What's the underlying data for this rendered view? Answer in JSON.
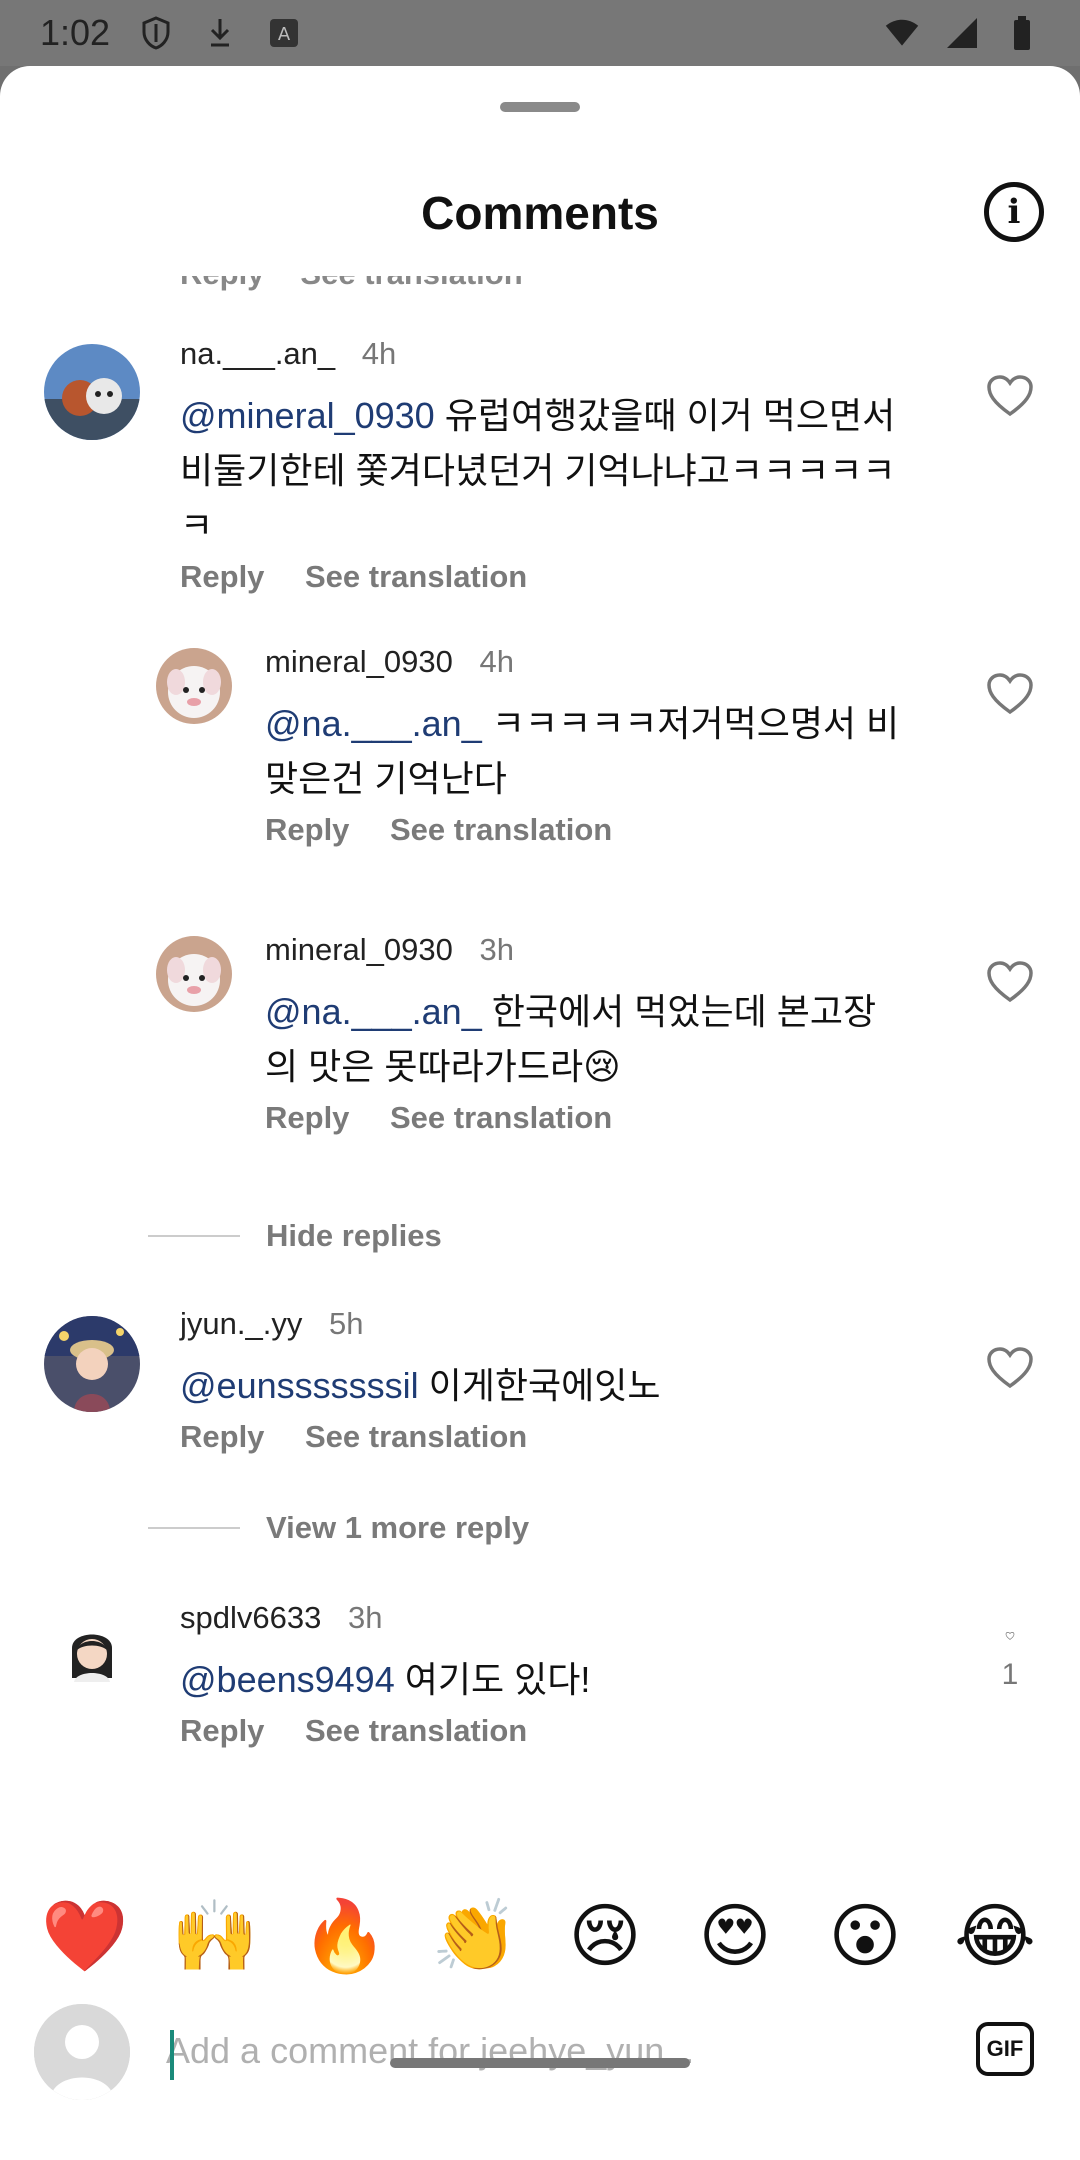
{
  "status_bar": {
    "time": "1:02"
  },
  "header": {
    "title": "Comments"
  },
  "partial": {
    "reply": "Reply",
    "see_translation": "See translation"
  },
  "comments": [
    {
      "user": "na.___.an_",
      "time": "4h",
      "mention": "@mineral_0930",
      "text": " 유럽여행갔을때 이거 먹으면서 비둘기한테 쫓겨다녔던거 기억나냐고ㅋㅋㅋㅋㅋㅋ",
      "reply": "Reply",
      "see_translation": "See translation"
    },
    {
      "user": "mineral_0930",
      "time": "4h",
      "mention": "@na.___.an_",
      "text": " ㅋㅋㅋㅋㅋ저거먹으명서 비맞은건 기억난다",
      "reply": "Reply",
      "see_translation": "See translation"
    },
    {
      "user": "mineral_0930",
      "time": "3h",
      "mention": "@na.___.an_",
      "text": " 한국에서 먹었는데 본고장의 맛은 못따라가드라😢",
      "reply": "Reply",
      "see_translation": "See translation"
    },
    {
      "user": "jyun._.yy",
      "time": "5h",
      "mention": "@eunsssssssil",
      "text": "  이게한국에잇노",
      "reply": "Reply",
      "see_translation": "See translation"
    },
    {
      "user": "spdlv6633",
      "time": "3h",
      "mention": "@beens9494",
      "text": " 여기도 있다!",
      "reply": "Reply",
      "see_translation": "See translation",
      "likes": "1"
    }
  ],
  "hide_replies": "Hide replies",
  "view_more": "View 1 more reply",
  "emojis": [
    "❤️",
    "🙌",
    "🔥",
    "👏",
    "😢",
    "😍",
    "😮",
    "😂"
  ],
  "composer": {
    "placeholder": "Add a comment for jeehye_yun...",
    "gif": "GIF"
  }
}
